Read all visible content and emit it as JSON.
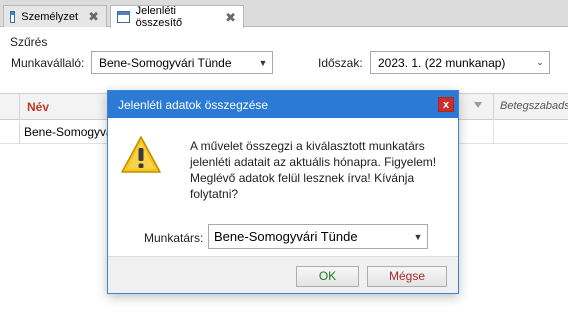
{
  "tabs": [
    {
      "label": "Személyzet",
      "icon": "window-icon",
      "active": false
    },
    {
      "label": "Jelenléti összesítő",
      "icon": "window-icon",
      "active": true
    }
  ],
  "filter": {
    "title": "Szűrés",
    "employee_label": "Munkavállaló:",
    "employee_value": "Bene-Somogyvári Tünde",
    "period_label": "Időszak:",
    "period_value": "2023. 1. (22 munkanap)"
  },
  "grid": {
    "columns": [
      "Név",
      "Betegszabads"
    ],
    "rows": [
      {
        "name": "Bene-Somogyvá"
      }
    ]
  },
  "dialog": {
    "title": "Jelenléti adatok összegzése",
    "close_glyph": "x",
    "message": "A művelet összegzi a kiválasztott munkatárs jelenléti adatait az aktuális hónapra. Figyelem! Meglévő adatok felül lesznek írva! Kívánja folytatni?",
    "colleague_label": "Munkatárs:",
    "colleague_value": "Bene-Somogyvári Tünde",
    "ok_label": "OK",
    "cancel_label": "Mégse"
  },
  "colors": {
    "dialog_titlebar": "#2b7bd6",
    "close_button": "#c9302c",
    "column_header_name": "#c0392b",
    "ok_text": "#1e7a1e",
    "cancel_text": "#a52a2a",
    "warning_fill": "#f5c518"
  }
}
